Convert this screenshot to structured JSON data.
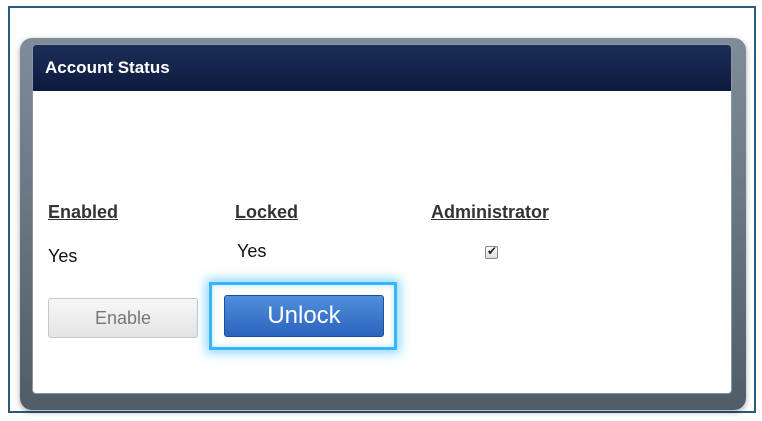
{
  "panel": {
    "title": "Account Status"
  },
  "columns": [
    {
      "header": "Enabled",
      "value": "Yes"
    },
    {
      "header": "Locked",
      "value": "Yes"
    },
    {
      "header": "Administrator",
      "checked": true
    }
  ],
  "buttons": {
    "enable_label": "Enable",
    "unlock_label": "Unlock"
  },
  "colors": {
    "header_bg": "#0d1a3e",
    "highlight": "#3ab4f2",
    "unlock_bg": "#2b63bd"
  }
}
